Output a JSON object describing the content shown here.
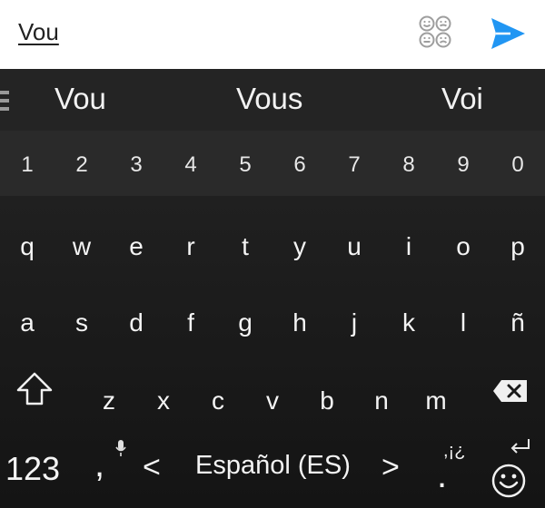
{
  "compose": {
    "text": "Vou",
    "emoji_icon": "emoji-faces-icon",
    "send_icon": "send-icon",
    "accent_color": "#2196F3"
  },
  "suggestions": [
    "Vou",
    "Vous",
    "Voi"
  ],
  "number_row": [
    "1",
    "2",
    "3",
    "4",
    "5",
    "6",
    "7",
    "8",
    "9",
    "0"
  ],
  "row1": [
    "q",
    "w",
    "e",
    "r",
    "t",
    "y",
    "u",
    "i",
    "o",
    "p"
  ],
  "row2": [
    "a",
    "s",
    "d",
    "f",
    "g",
    "h",
    "j",
    "k",
    "l",
    "ñ"
  ],
  "row3": [
    "z",
    "x",
    "c",
    "v",
    "b",
    "n",
    "m"
  ],
  "bottom": {
    "symbols_key": "123",
    "comma_key": ",",
    "language": "Español (ES)",
    "prev_lang": "<",
    "next_lang": ">",
    "punct_key": ",¡¿",
    "period_key": "."
  }
}
